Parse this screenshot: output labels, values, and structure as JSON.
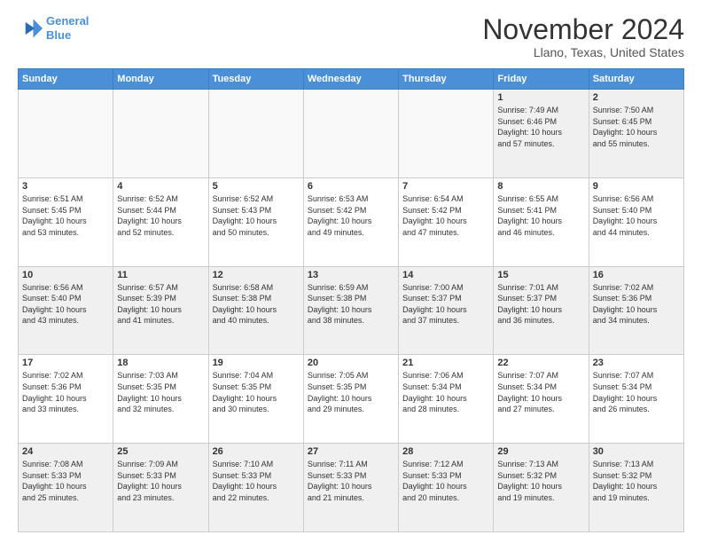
{
  "logo": {
    "line1": "General",
    "line2": "Blue"
  },
  "header": {
    "month": "November 2024",
    "location": "Llano, Texas, United States"
  },
  "days_of_week": [
    "Sunday",
    "Monday",
    "Tuesday",
    "Wednesday",
    "Thursday",
    "Friday",
    "Saturday"
  ],
  "weeks": [
    [
      {
        "day": "",
        "info": ""
      },
      {
        "day": "",
        "info": ""
      },
      {
        "day": "",
        "info": ""
      },
      {
        "day": "",
        "info": ""
      },
      {
        "day": "",
        "info": ""
      },
      {
        "day": "1",
        "info": "Sunrise: 7:49 AM\nSunset: 6:46 PM\nDaylight: 10 hours\nand 57 minutes."
      },
      {
        "day": "2",
        "info": "Sunrise: 7:50 AM\nSunset: 6:45 PM\nDaylight: 10 hours\nand 55 minutes."
      }
    ],
    [
      {
        "day": "3",
        "info": "Sunrise: 6:51 AM\nSunset: 5:45 PM\nDaylight: 10 hours\nand 53 minutes."
      },
      {
        "day": "4",
        "info": "Sunrise: 6:52 AM\nSunset: 5:44 PM\nDaylight: 10 hours\nand 52 minutes."
      },
      {
        "day": "5",
        "info": "Sunrise: 6:52 AM\nSunset: 5:43 PM\nDaylight: 10 hours\nand 50 minutes."
      },
      {
        "day": "6",
        "info": "Sunrise: 6:53 AM\nSunset: 5:42 PM\nDaylight: 10 hours\nand 49 minutes."
      },
      {
        "day": "7",
        "info": "Sunrise: 6:54 AM\nSunset: 5:42 PM\nDaylight: 10 hours\nand 47 minutes."
      },
      {
        "day": "8",
        "info": "Sunrise: 6:55 AM\nSunset: 5:41 PM\nDaylight: 10 hours\nand 46 minutes."
      },
      {
        "day": "9",
        "info": "Sunrise: 6:56 AM\nSunset: 5:40 PM\nDaylight: 10 hours\nand 44 minutes."
      }
    ],
    [
      {
        "day": "10",
        "info": "Sunrise: 6:56 AM\nSunset: 5:40 PM\nDaylight: 10 hours\nand 43 minutes."
      },
      {
        "day": "11",
        "info": "Sunrise: 6:57 AM\nSunset: 5:39 PM\nDaylight: 10 hours\nand 41 minutes."
      },
      {
        "day": "12",
        "info": "Sunrise: 6:58 AM\nSunset: 5:38 PM\nDaylight: 10 hours\nand 40 minutes."
      },
      {
        "day": "13",
        "info": "Sunrise: 6:59 AM\nSunset: 5:38 PM\nDaylight: 10 hours\nand 38 minutes."
      },
      {
        "day": "14",
        "info": "Sunrise: 7:00 AM\nSunset: 5:37 PM\nDaylight: 10 hours\nand 37 minutes."
      },
      {
        "day": "15",
        "info": "Sunrise: 7:01 AM\nSunset: 5:37 PM\nDaylight: 10 hours\nand 36 minutes."
      },
      {
        "day": "16",
        "info": "Sunrise: 7:02 AM\nSunset: 5:36 PM\nDaylight: 10 hours\nand 34 minutes."
      }
    ],
    [
      {
        "day": "17",
        "info": "Sunrise: 7:02 AM\nSunset: 5:36 PM\nDaylight: 10 hours\nand 33 minutes."
      },
      {
        "day": "18",
        "info": "Sunrise: 7:03 AM\nSunset: 5:35 PM\nDaylight: 10 hours\nand 32 minutes."
      },
      {
        "day": "19",
        "info": "Sunrise: 7:04 AM\nSunset: 5:35 PM\nDaylight: 10 hours\nand 30 minutes."
      },
      {
        "day": "20",
        "info": "Sunrise: 7:05 AM\nSunset: 5:35 PM\nDaylight: 10 hours\nand 29 minutes."
      },
      {
        "day": "21",
        "info": "Sunrise: 7:06 AM\nSunset: 5:34 PM\nDaylight: 10 hours\nand 28 minutes."
      },
      {
        "day": "22",
        "info": "Sunrise: 7:07 AM\nSunset: 5:34 PM\nDaylight: 10 hours\nand 27 minutes."
      },
      {
        "day": "23",
        "info": "Sunrise: 7:07 AM\nSunset: 5:34 PM\nDaylight: 10 hours\nand 26 minutes."
      }
    ],
    [
      {
        "day": "24",
        "info": "Sunrise: 7:08 AM\nSunset: 5:33 PM\nDaylight: 10 hours\nand 25 minutes."
      },
      {
        "day": "25",
        "info": "Sunrise: 7:09 AM\nSunset: 5:33 PM\nDaylight: 10 hours\nand 23 minutes."
      },
      {
        "day": "26",
        "info": "Sunrise: 7:10 AM\nSunset: 5:33 PM\nDaylight: 10 hours\nand 22 minutes."
      },
      {
        "day": "27",
        "info": "Sunrise: 7:11 AM\nSunset: 5:33 PM\nDaylight: 10 hours\nand 21 minutes."
      },
      {
        "day": "28",
        "info": "Sunrise: 7:12 AM\nSunset: 5:33 PM\nDaylight: 10 hours\nand 20 minutes."
      },
      {
        "day": "29",
        "info": "Sunrise: 7:13 AM\nSunset: 5:32 PM\nDaylight: 10 hours\nand 19 minutes."
      },
      {
        "day": "30",
        "info": "Sunrise: 7:13 AM\nSunset: 5:32 PM\nDaylight: 10 hours\nand 19 minutes."
      }
    ]
  ]
}
